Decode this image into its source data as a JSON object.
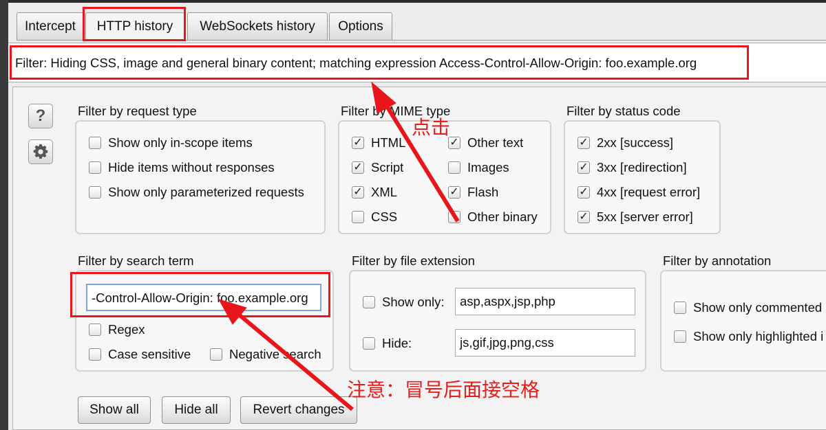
{
  "tabs": [
    {
      "label": "Intercept"
    },
    {
      "label": "HTTP history"
    },
    {
      "label": "WebSockets history"
    },
    {
      "label": "Options"
    }
  ],
  "filter_bar": {
    "text": "Filter: Hiding CSS, image and general binary content;  matching expression Access-Control-Allow-Origin: foo.example.org"
  },
  "side_buttons": {
    "help_icon": "question-icon",
    "settings_icon": "gear-icon"
  },
  "request_type": {
    "title": "Filter by request type",
    "options": [
      {
        "label": "Show only in-scope items",
        "checked": false
      },
      {
        "label": "Hide items without responses",
        "checked": false
      },
      {
        "label": "Show only parameterized requests",
        "checked": false
      }
    ]
  },
  "mime_type": {
    "title": "Filter by MIME type",
    "options": [
      {
        "label": "HTML",
        "checked": true
      },
      {
        "label": "Other text",
        "checked": true
      },
      {
        "label": "Script",
        "checked": true
      },
      {
        "label": "Images",
        "checked": false
      },
      {
        "label": "XML",
        "checked": true
      },
      {
        "label": "Flash",
        "checked": true
      },
      {
        "label": "CSS",
        "checked": false
      },
      {
        "label": "Other binary",
        "checked": false
      }
    ]
  },
  "status_code": {
    "title": "Filter by status code",
    "options": [
      {
        "label": "2xx  [success]",
        "checked": true
      },
      {
        "label": "3xx  [redirection]",
        "checked": true
      },
      {
        "label": "4xx  [request error]",
        "checked": true
      },
      {
        "label": "5xx  [server error]",
        "checked": true
      }
    ]
  },
  "search_term": {
    "title": "Filter by search term",
    "value": "-Control-Allow-Origin: foo.example.org",
    "regex": {
      "label": "Regex",
      "checked": false
    },
    "case_sensitive": {
      "label": "Case sensitive",
      "checked": false
    },
    "negative_search": {
      "label": "Negative search",
      "checked": false
    }
  },
  "file_extension": {
    "title": "Filter by file extension",
    "show_only": {
      "label": "Show only:",
      "checked": false,
      "value": "asp,aspx,jsp,php"
    },
    "hide": {
      "label": "Hide:",
      "checked": false,
      "value": "js,gif,jpg,png,css"
    }
  },
  "annotation": {
    "title": "Filter by annotation",
    "options": [
      {
        "label": "Show only commented",
        "checked": false
      },
      {
        "label": "Show only highlighted i",
        "checked": false
      }
    ]
  },
  "buttons": {
    "show_all": "Show all",
    "hide_all": "Hide all",
    "revert": "Revert changes"
  },
  "annotations": {
    "click": "点击",
    "note": "注意：冒号后面接空格",
    "color": "#e8161a"
  }
}
